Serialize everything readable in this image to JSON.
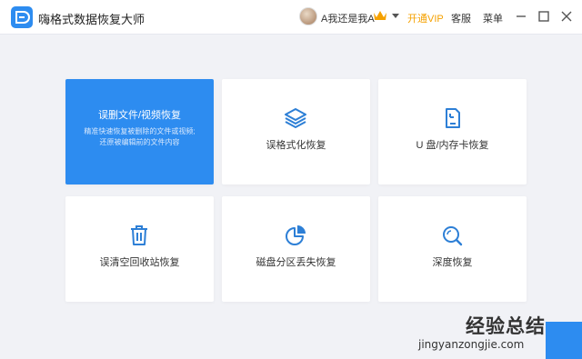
{
  "app": {
    "title": "嗨格式数据恢复大师"
  },
  "header": {
    "username": "A我还是我A",
    "vip_label": "开通VIP",
    "service_label": "客服",
    "menu_label": "菜单"
  },
  "cards": [
    {
      "title": "误删文件/视频恢复",
      "desc_line1": "精准快速恢复被删除的文件或视频;",
      "desc_line2": "还原被编辑前的文件内容",
      "icon": "none",
      "active": true
    },
    {
      "title": "误格式化恢复",
      "icon": "layers-icon"
    },
    {
      "title": "U 盘/内存卡恢复",
      "icon": "sd-card-icon"
    },
    {
      "title": "误清空回收站恢复",
      "icon": "trash-icon"
    },
    {
      "title": "磁盘分区丢失恢复",
      "icon": "pie-chart-icon"
    },
    {
      "title": "深度恢复",
      "icon": "search-icon"
    }
  ],
  "watermark": {
    "title": "经验总结",
    "url": "jingyanzongjie.com"
  },
  "colors": {
    "accent": "#2d8cf0",
    "vip": "#f5a100",
    "background": "#f1f2f6"
  }
}
